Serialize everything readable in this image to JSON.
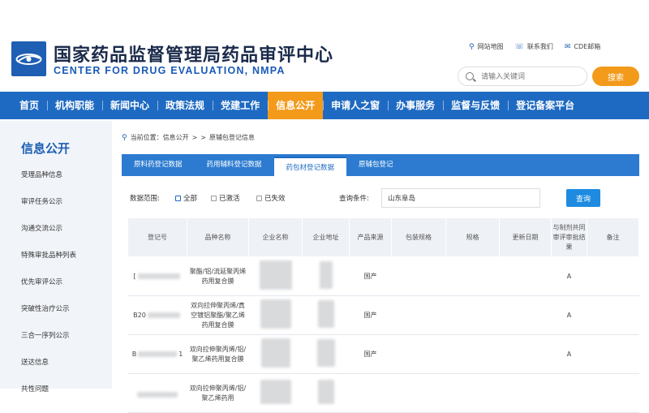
{
  "header": {
    "title_cn": "国家药品监督管理局药品审评中心",
    "title_en": "CENTER FOR DRUG EVALUATION, NMPA",
    "links": [
      "网站地图",
      "联系我们",
      "CDE邮箱"
    ],
    "search_placeholder": "请输入关键词",
    "search_button": "搜索"
  },
  "nav": [
    "首页",
    "机构职能",
    "新闻中心",
    "政策法规",
    "党建工作",
    "信息公开",
    "申请人之窗",
    "办事服务",
    "监督与反馈",
    "登记备案平台"
  ],
  "sidebar": {
    "title": "信息公开",
    "items": [
      "受理品种信息",
      "审评任务公示",
      "沟通交流公示",
      "特殊审批品种列表",
      "优先审评公示",
      "突破性治疗公示",
      "三合一序列公示",
      "送达信息",
      "共性问题"
    ]
  },
  "breadcrumb": [
    "当前位置：信息公开",
    ">",
    ">",
    "原辅包登记信息"
  ],
  "tabs": [
    "原料药登记数据",
    "药用辅料登记数据",
    "药包材登记数据",
    "原辅包登记"
  ],
  "filter": {
    "range_label": "数据范围:",
    "options": [
      "全部",
      "已激活",
      "已失效"
    ],
    "query_label": "查询条件:",
    "query_value": "山东阜岛",
    "query_button": "查询"
  },
  "table": {
    "headers": [
      "登记号",
      "品种名称",
      "企业名称",
      "企业地址",
      "产品来源",
      "包装规格",
      "规格",
      "更新日期",
      "与制剂共同审评审批结果",
      "备注"
    ],
    "rows": [
      {
        "reg_prefix": "[",
        "reg_suffix": "",
        "name": "聚酯/铝/流延聚丙烯药用复合膜",
        "source": "国产",
        "result": "A"
      },
      {
        "reg_prefix": "B20",
        "reg_suffix": "",
        "name": "双向拉伸聚丙烯/真空镀铝聚酯/聚乙烯药用复合膜",
        "source": "国产",
        "result": "A"
      },
      {
        "reg_prefix": "B",
        "reg_suffix": "1",
        "name": "双向拉伸聚丙烯/铝/聚乙烯药用复合膜",
        "source": "国产",
        "result": "A"
      },
      {
        "reg_prefix": "",
        "reg_suffix": "",
        "name": "双向拉伸聚丙烯/铝/聚乙烯药用",
        "source": "",
        "result": ""
      }
    ]
  },
  "colors": {
    "nav_blue": "#1e6ac2",
    "accent_orange": "#f39a1a",
    "tab_blue": "#2c7bd1"
  }
}
